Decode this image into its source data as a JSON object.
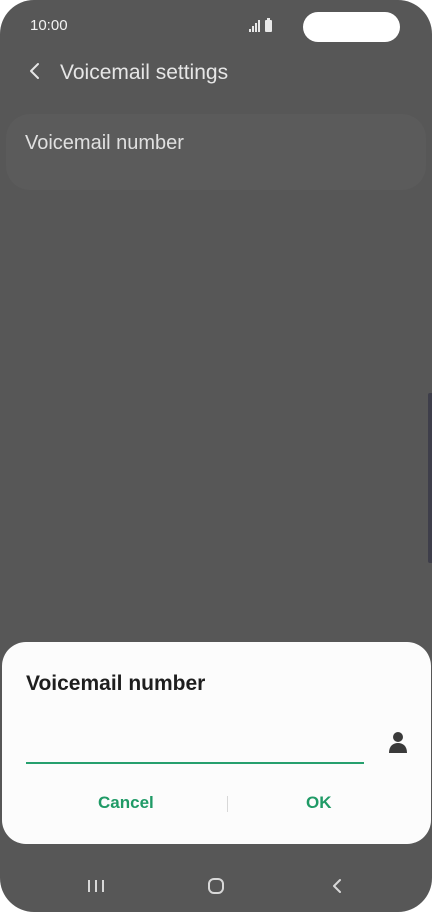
{
  "status_bar": {
    "time": "10:00"
  },
  "header": {
    "title": "Voicemail settings",
    "back_icon": "chevron-left-icon"
  },
  "settings": {
    "items": [
      {
        "label": "Voicemail number"
      }
    ]
  },
  "dialog": {
    "title": "Voicemail number",
    "input_value": "",
    "contact_icon": "person-icon",
    "cancel_label": "Cancel",
    "ok_label": "OK",
    "accent_color": "#1f9a66"
  },
  "nav_bar": {
    "recents_icon": "recents-icon",
    "home_icon": "home-icon",
    "back_icon": "back-icon"
  }
}
